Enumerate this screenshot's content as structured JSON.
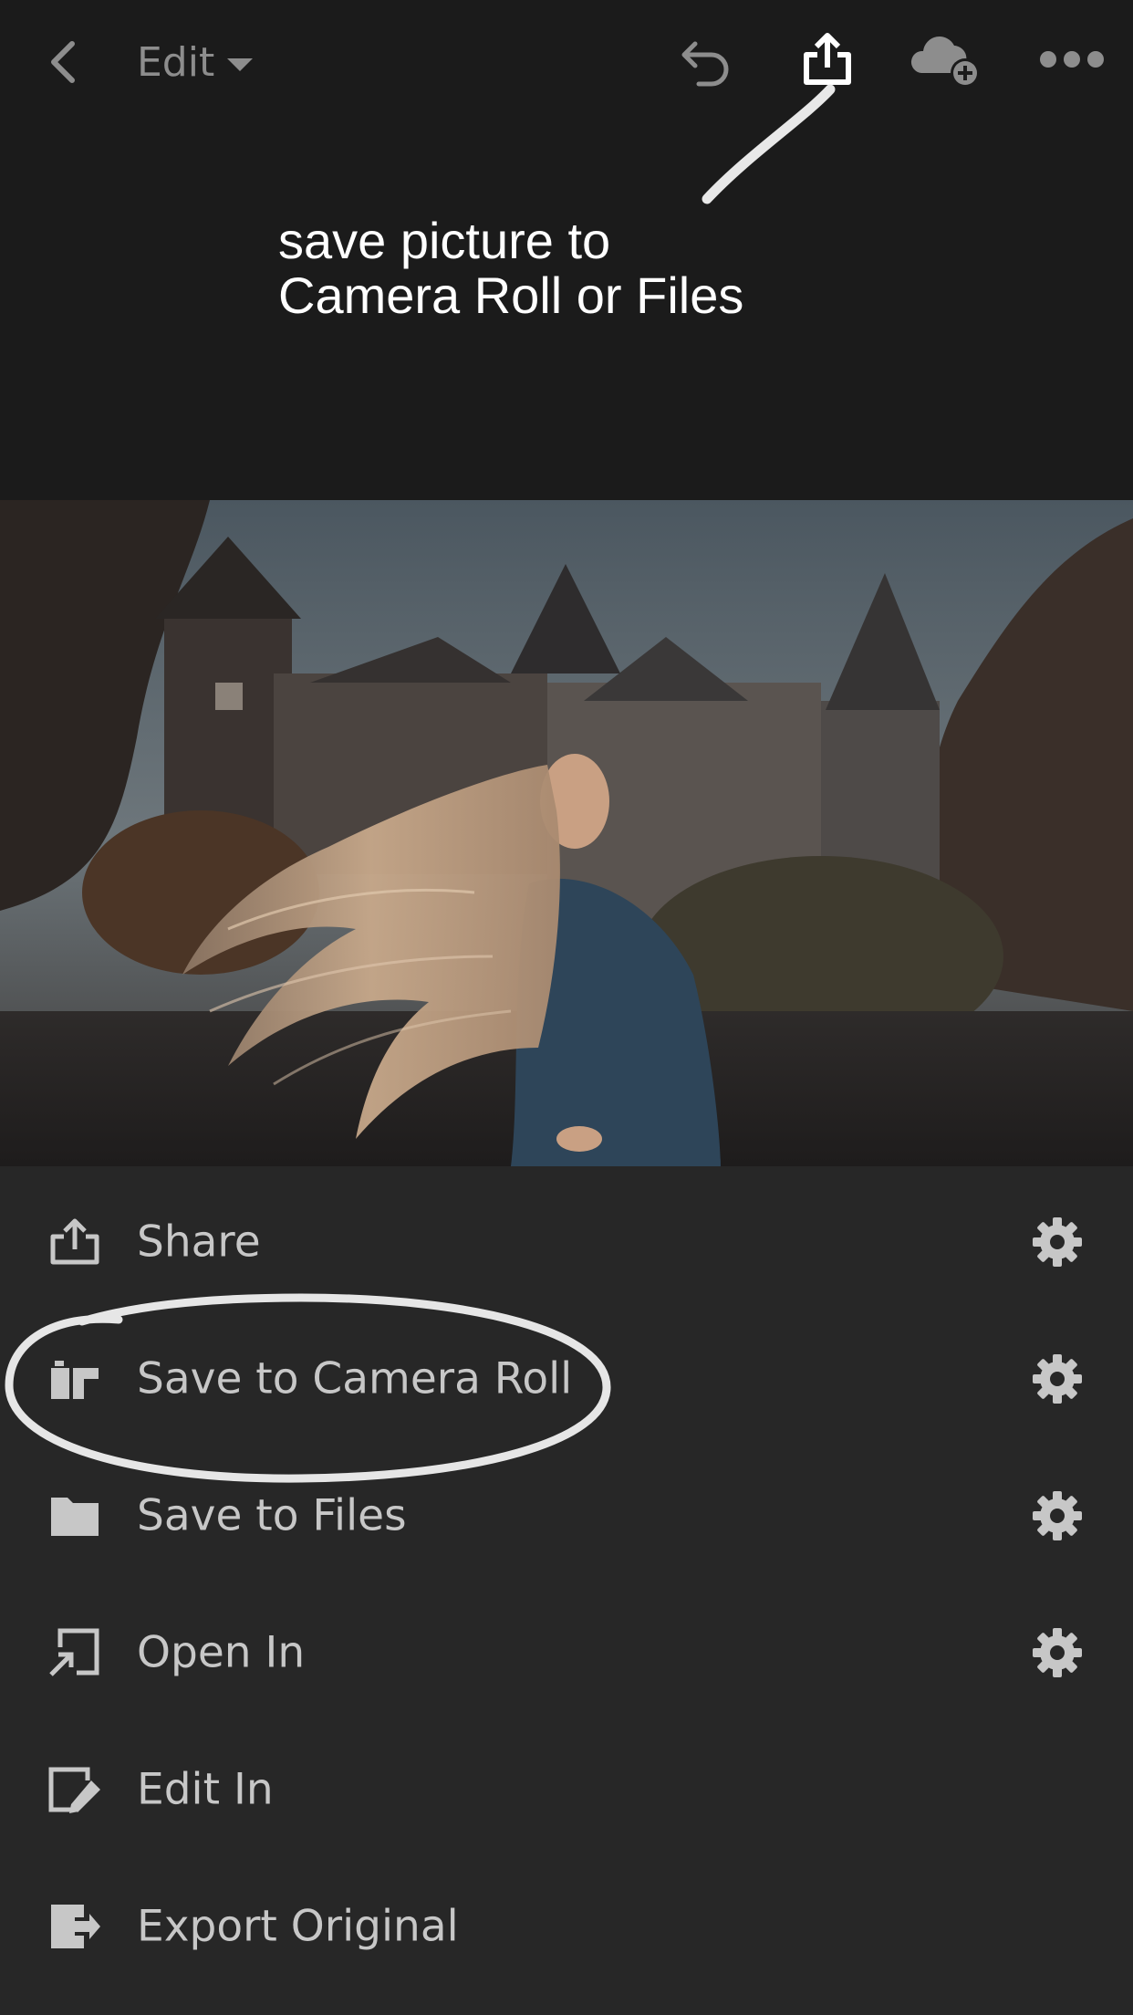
{
  "topbar": {
    "back_icon": "chevron-left-icon",
    "edit_label": "Edit",
    "edit_caret_icon": "caret-down-icon",
    "undo_icon": "undo-icon",
    "share_icon": "share-icon",
    "cloud_icon": "cloud-add-icon",
    "more_icon": "more-horizontal-icon"
  },
  "annotation": {
    "text": "save picture to\nCamera Roll or Files"
  },
  "photo": {
    "subject": "woman with flowing hair in front of castle"
  },
  "menu": {
    "items": [
      {
        "label": "Share",
        "icon": "share-icon",
        "settings": true
      },
      {
        "label": "Save to Camera Roll",
        "icon": "camera-roll-icon",
        "settings": true
      },
      {
        "label": "Save to Files",
        "icon": "folder-icon",
        "settings": true
      },
      {
        "label": "Open In",
        "icon": "open-in-icon",
        "settings": true
      },
      {
        "label": "Edit In",
        "icon": "edit-in-icon",
        "settings": false
      },
      {
        "label": "Export Original",
        "icon": "export-icon",
        "settings": false
      }
    ]
  },
  "colors": {
    "background": "#1b1b1b",
    "menu_background": "#272727",
    "text": "#c7c7c7",
    "icon_muted": "#8d8d8d",
    "annotation": "#ffffff"
  }
}
